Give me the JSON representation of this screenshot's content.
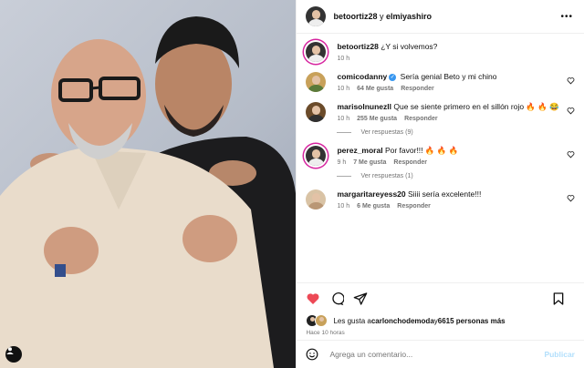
{
  "header": {
    "title_user1": "betoortiz28",
    "title_connector": " y ",
    "title_user2": "elmiyashiro"
  },
  "caption": {
    "user": "betoortiz28",
    "text": "¿Y si volvemos?",
    "time": "10 h"
  },
  "comments": [
    {
      "user": "comicodanny",
      "verified": true,
      "text": "Sería genial Beto y mi chino",
      "time": "10 h",
      "likes": "64 Me gusta",
      "reply": "Responder"
    },
    {
      "user": "marisolnunezll",
      "text": "Que se siente primero en el sillón rojo 🔥 🔥 😂",
      "time": "10 h",
      "likes": "255 Me gusta",
      "reply": "Responder",
      "view_replies": "Ver respuestas (9)"
    },
    {
      "user": "perez_moral",
      "text": "Por favor!!! 🔥 🔥 🔥",
      "time": "9 h",
      "likes": "7 Me gusta",
      "reply": "Responder",
      "view_replies": "Ver respuestas (1)"
    },
    {
      "user": "margaritareyess20",
      "text": "Siiii sería excelente!!!",
      "time": "10 h",
      "likes": "6 Me gusta",
      "reply": "Responder"
    }
  ],
  "likes": {
    "prefix": "Les gusta a ",
    "user": "carlonchodemoda",
    "connector": " y ",
    "others": "6615 personas más"
  },
  "post_time": "Hace 10 horas",
  "add_comment": {
    "placeholder": "Agrega un comentario...",
    "publish": "Publicar"
  },
  "colors": {
    "like_red": "#ed4956",
    "verified_blue": "#3897f0",
    "publish_disabled": "#b2dffc",
    "story_ring": "#d6249f"
  },
  "icons": [
    "more-icon",
    "heart-filled-icon",
    "comment-icon",
    "share-icon",
    "bookmark-icon",
    "emoji-icon",
    "heart-outline-icon",
    "user-tag-icon"
  ]
}
